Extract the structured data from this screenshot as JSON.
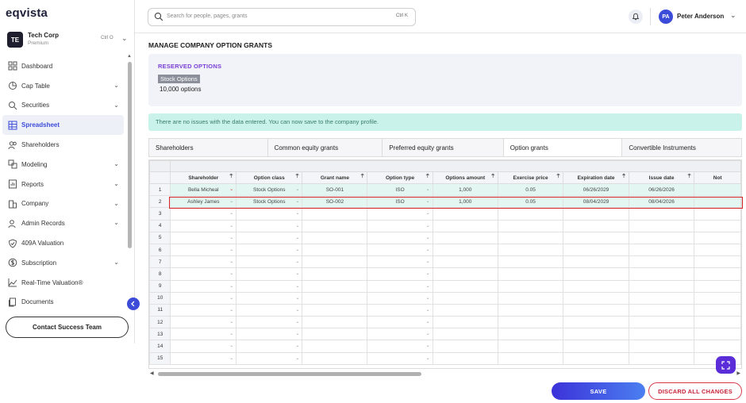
{
  "app": {
    "logo": "eqvista"
  },
  "org": {
    "initials": "TE",
    "name": "Tech Corp",
    "plan": "Premium",
    "shortcut": "Ctrl O"
  },
  "sidebar": {
    "items": [
      {
        "label": "Dashboard",
        "icon": "dashboard-icon",
        "chevron": false,
        "active": false
      },
      {
        "label": "Cap Table",
        "icon": "pie-chart-icon",
        "chevron": true,
        "active": false
      },
      {
        "label": "Securities",
        "icon": "securities-icon",
        "chevron": true,
        "active": false
      },
      {
        "label": "Spreadsheet",
        "icon": "grid-icon",
        "chevron": false,
        "active": true
      },
      {
        "label": "Shareholders",
        "icon": "users-icon",
        "chevron": false,
        "active": false
      },
      {
        "label": "Modeling",
        "icon": "modeling-icon",
        "chevron": true,
        "active": false
      },
      {
        "label": "Reports",
        "icon": "reports-icon",
        "chevron": true,
        "active": false
      },
      {
        "label": "Company",
        "icon": "company-icon",
        "chevron": true,
        "active": false
      },
      {
        "label": "Admin Records",
        "icon": "records-icon",
        "chevron": true,
        "active": false
      },
      {
        "label": "409A Valuation",
        "icon": "shield-check-icon",
        "chevron": false,
        "active": false
      },
      {
        "label": "Subscription",
        "icon": "dollar-icon",
        "chevron": true,
        "active": false
      },
      {
        "label": "Real-Time Valuation®",
        "icon": "trend-icon",
        "chevron": false,
        "active": false
      },
      {
        "label": "Documents",
        "icon": "documents-icon",
        "chevron": false,
        "active": false
      }
    ],
    "contact_label": "Contact Success Team"
  },
  "header": {
    "search_placeholder": "Search for people, pages, grants",
    "search_shortcut": "Ctrl K",
    "user_initials": "PA",
    "user_name": "Peter Anderson"
  },
  "main": {
    "title": "MANAGE COMPANY OPTION GRANTS",
    "reserved": {
      "title": "RESERVED OPTIONS",
      "tag": "Stock Options",
      "count": "10,000  options"
    },
    "notice": "There are no issues with the data entered. You can now save to the company profile.",
    "tabs": [
      {
        "label": "Shareholders",
        "active": false
      },
      {
        "label": "Common equity grants",
        "active": false
      },
      {
        "label": "Preferred equity grants",
        "active": false
      },
      {
        "label": "Option grants",
        "active": true
      },
      {
        "label": "Convertible Instruments",
        "active": false
      }
    ]
  },
  "grid": {
    "columns": [
      "Shareholder",
      "Option class",
      "Grant name",
      "Option type",
      "Options amount",
      "Exercise price",
      "Expiration date",
      "Issue date",
      "Not"
    ],
    "rows": [
      [
        "Bella Micheal",
        "Stock Options",
        "SO-001",
        "ISO",
        "1,000",
        "0.05",
        "06/26/2029",
        "06/26/2026",
        ""
      ],
      [
        "Ashley James",
        "Stock Options",
        "SO-002",
        "ISO",
        "1,000",
        "0.05",
        "08/04/2029",
        "08/04/2026",
        ""
      ]
    ],
    "row_numbers": [
      "1",
      "2",
      "3",
      "4",
      "5",
      "6",
      "7",
      "8",
      "9",
      "10",
      "11",
      "12",
      "13",
      "14",
      "15"
    ]
  },
  "actions": {
    "save": "SAVE",
    "discard": "DISCARD ALL CHANGES"
  },
  "colors": {
    "accent": "#3d4bd9",
    "purple": "#7b3fd6",
    "notice_bg": "#c9f2ea",
    "danger": "#d83a4a"
  }
}
